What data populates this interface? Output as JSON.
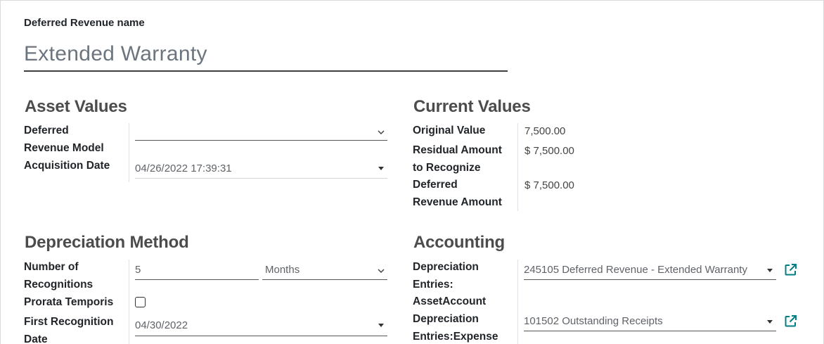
{
  "name_field": {
    "label": "Deferred Revenue name",
    "value": "Extended Warranty"
  },
  "asset_values": {
    "title": "Asset Values",
    "deferred_revenue_model_label_line1": "Deferred",
    "deferred_revenue_model_label_line2": "Revenue Model",
    "deferred_revenue_model_value": "",
    "acquisition_date_label": "Acquisition Date",
    "acquisition_date_value": "04/26/2022 17:39:31"
  },
  "current_values": {
    "title": "Current Values",
    "original_value_label": "Original Value",
    "original_value": "7,500.00",
    "residual_label_line1": "Residual Amount",
    "residual_label_line2": "to Recognize",
    "residual_value": "$ 7,500.00",
    "deferred_amount_label_line1": "Deferred",
    "deferred_amount_label_line2": "Revenue Amount",
    "deferred_amount_value": "$ 7,500.00"
  },
  "depreciation_method": {
    "title": "Depreciation Method",
    "number_label_line1": "Number of",
    "number_label_line2": "Recognitions",
    "number_value": "5",
    "period_unit": "Months",
    "prorata_label": "Prorata Temporis",
    "prorata_checked": false,
    "first_recognition_label_line1": "First Recognition",
    "first_recognition_label_line2": "Date",
    "first_recognition_value": "04/30/2022"
  },
  "accounting": {
    "title": "Accounting",
    "asset_account_label_line1": "Depreciation",
    "asset_account_label_line2": "Entries:",
    "asset_account_label_line3": "AssetAccount",
    "asset_account_value": "245105 Deferred Revenue - Extended Warranty",
    "expense_account_label_line1": "Depreciation",
    "expense_account_label_line2": "Entries:Expense",
    "expense_account_value": "101502 Outstanding Receipts"
  },
  "colors": {
    "link_icon": "#017e84",
    "section_title": "#4c4c4c"
  },
  "icons": [
    "chevron-down-icon",
    "caret-down-icon",
    "external-link-icon",
    "checkbox-icon"
  ]
}
